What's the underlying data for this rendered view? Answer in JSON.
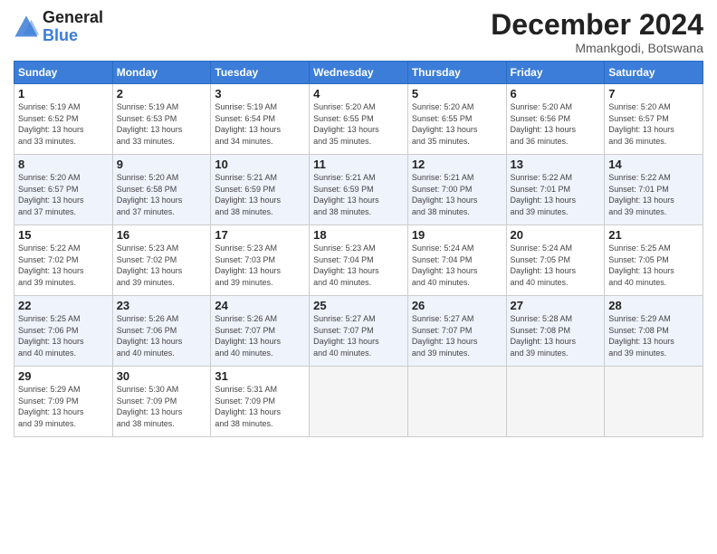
{
  "header": {
    "logo_text_general": "General",
    "logo_text_blue": "Blue",
    "month_title": "December 2024",
    "location": "Mmankgodi, Botswana"
  },
  "days_of_week": [
    "Sunday",
    "Monday",
    "Tuesday",
    "Wednesday",
    "Thursday",
    "Friday",
    "Saturday"
  ],
  "weeks": [
    [
      {
        "num": "1",
        "rise": "5:19 AM",
        "set": "6:52 PM",
        "daylight": "13 hours and 33 minutes."
      },
      {
        "num": "2",
        "rise": "5:19 AM",
        "set": "6:53 PM",
        "daylight": "13 hours and 33 minutes."
      },
      {
        "num": "3",
        "rise": "5:19 AM",
        "set": "6:54 PM",
        "daylight": "13 hours and 34 minutes."
      },
      {
        "num": "4",
        "rise": "5:20 AM",
        "set": "6:55 PM",
        "daylight": "13 hours and 35 minutes."
      },
      {
        "num": "5",
        "rise": "5:20 AM",
        "set": "6:55 PM",
        "daylight": "13 hours and 35 minutes."
      },
      {
        "num": "6",
        "rise": "5:20 AM",
        "set": "6:56 PM",
        "daylight": "13 hours and 36 minutes."
      },
      {
        "num": "7",
        "rise": "5:20 AM",
        "set": "6:57 PM",
        "daylight": "13 hours and 36 minutes."
      }
    ],
    [
      {
        "num": "8",
        "rise": "5:20 AM",
        "set": "6:57 PM",
        "daylight": "13 hours and 37 minutes."
      },
      {
        "num": "9",
        "rise": "5:20 AM",
        "set": "6:58 PM",
        "daylight": "13 hours and 37 minutes."
      },
      {
        "num": "10",
        "rise": "5:21 AM",
        "set": "6:59 PM",
        "daylight": "13 hours and 38 minutes."
      },
      {
        "num": "11",
        "rise": "5:21 AM",
        "set": "6:59 PM",
        "daylight": "13 hours and 38 minutes."
      },
      {
        "num": "12",
        "rise": "5:21 AM",
        "set": "7:00 PM",
        "daylight": "13 hours and 38 minutes."
      },
      {
        "num": "13",
        "rise": "5:22 AM",
        "set": "7:01 PM",
        "daylight": "13 hours and 39 minutes."
      },
      {
        "num": "14",
        "rise": "5:22 AM",
        "set": "7:01 PM",
        "daylight": "13 hours and 39 minutes."
      }
    ],
    [
      {
        "num": "15",
        "rise": "5:22 AM",
        "set": "7:02 PM",
        "daylight": "13 hours and 39 minutes."
      },
      {
        "num": "16",
        "rise": "5:23 AM",
        "set": "7:02 PM",
        "daylight": "13 hours and 39 minutes."
      },
      {
        "num": "17",
        "rise": "5:23 AM",
        "set": "7:03 PM",
        "daylight": "13 hours and 39 minutes."
      },
      {
        "num": "18",
        "rise": "5:23 AM",
        "set": "7:04 PM",
        "daylight": "13 hours and 40 minutes."
      },
      {
        "num": "19",
        "rise": "5:24 AM",
        "set": "7:04 PM",
        "daylight": "13 hours and 40 minutes."
      },
      {
        "num": "20",
        "rise": "5:24 AM",
        "set": "7:05 PM",
        "daylight": "13 hours and 40 minutes."
      },
      {
        "num": "21",
        "rise": "5:25 AM",
        "set": "7:05 PM",
        "daylight": "13 hours and 40 minutes."
      }
    ],
    [
      {
        "num": "22",
        "rise": "5:25 AM",
        "set": "7:06 PM",
        "daylight": "13 hours and 40 minutes."
      },
      {
        "num": "23",
        "rise": "5:26 AM",
        "set": "7:06 PM",
        "daylight": "13 hours and 40 minutes."
      },
      {
        "num": "24",
        "rise": "5:26 AM",
        "set": "7:07 PM",
        "daylight": "13 hours and 40 minutes."
      },
      {
        "num": "25",
        "rise": "5:27 AM",
        "set": "7:07 PM",
        "daylight": "13 hours and 40 minutes."
      },
      {
        "num": "26",
        "rise": "5:27 AM",
        "set": "7:07 PM",
        "daylight": "13 hours and 39 minutes."
      },
      {
        "num": "27",
        "rise": "5:28 AM",
        "set": "7:08 PM",
        "daylight": "13 hours and 39 minutes."
      },
      {
        "num": "28",
        "rise": "5:29 AM",
        "set": "7:08 PM",
        "daylight": "13 hours and 39 minutes."
      }
    ],
    [
      {
        "num": "29",
        "rise": "5:29 AM",
        "set": "7:09 PM",
        "daylight": "13 hours and 39 minutes."
      },
      {
        "num": "30",
        "rise": "5:30 AM",
        "set": "7:09 PM",
        "daylight": "13 hours and 38 minutes."
      },
      {
        "num": "31",
        "rise": "5:31 AM",
        "set": "7:09 PM",
        "daylight": "13 hours and 38 minutes."
      },
      null,
      null,
      null,
      null
    ]
  ]
}
